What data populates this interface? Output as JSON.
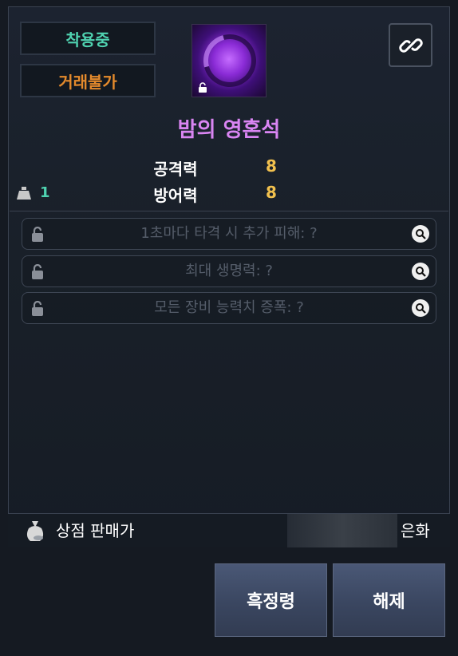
{
  "item": {
    "status_equipped": "착용중",
    "status_untradable": "거래불가",
    "name": "밤의 영혼석",
    "icon": "night-soul-stone-icon",
    "colors": {
      "name": "#d985f2",
      "equipped": "#4fd2b0",
      "untradable": "#e48a2c",
      "stat_value": "#f2c14e"
    }
  },
  "stats": [
    {
      "label": "공격력",
      "value": "8"
    },
    {
      "label": "방어력",
      "value": "8"
    }
  ],
  "weight": {
    "value": "1"
  },
  "options": [
    {
      "text": "1초마다 타격 시 추가 피해: ?"
    },
    {
      "text": "최대 생명력: ?"
    },
    {
      "text": "모든 장비 능력치 증폭: ?"
    }
  ],
  "sale": {
    "label": "상점 판매가",
    "currency": "은화"
  },
  "buttons": {
    "bind": "흑정령",
    "release": "해제"
  }
}
